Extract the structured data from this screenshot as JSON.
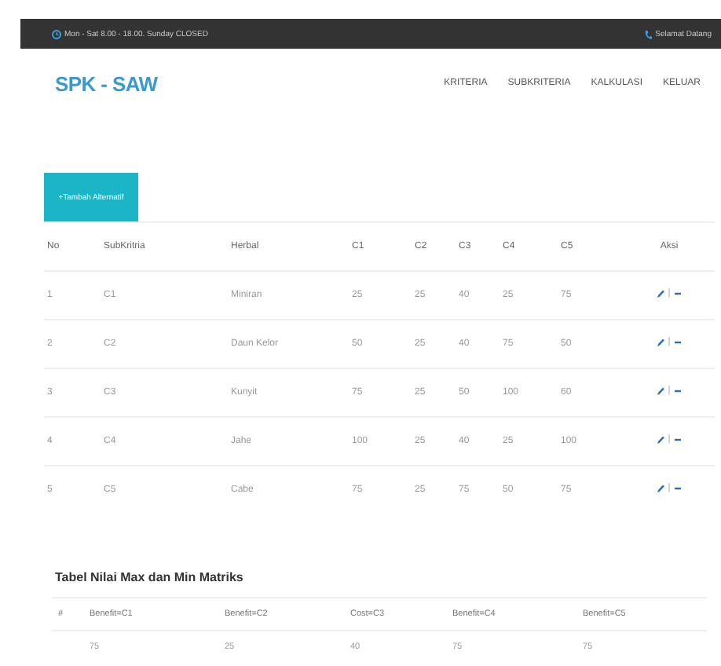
{
  "top_bar": {
    "hours": "Mon - Sat 8.00 - 18.00. Sunday CLOSED",
    "greeting": "Selamat Datang"
  },
  "header": {
    "logo": "SPK - SAW",
    "nav": [
      {
        "label": "KRITERIA"
      },
      {
        "label": "SUBKRITERIA"
      },
      {
        "label": "KALKULASI"
      },
      {
        "label": "KELUAR"
      }
    ]
  },
  "add_button": "+Tambah Alternatif",
  "table": {
    "columns": [
      "No",
      "SubKritria",
      "Herbal",
      "C1",
      "C2",
      "C3",
      "C4",
      "C5",
      "Aksi"
    ],
    "rows": [
      {
        "cells": [
          "1",
          "C1",
          "Miniran",
          "25",
          "25",
          "40",
          "25",
          "75"
        ],
        "separator": "|"
      },
      {
        "cells": [
          "2",
          "C2",
          "Daun Kelor",
          "50",
          "25",
          "40",
          "75",
          "50"
        ],
        "separator": "|"
      },
      {
        "cells": [
          "3",
          "C3",
          "Kunyit",
          "75",
          "25",
          "50",
          "100",
          "60"
        ],
        "separator": "|"
      },
      {
        "cells": [
          "4",
          "C4",
          "Jahe",
          "100",
          "25",
          "40",
          "25",
          "100"
        ],
        "separator": "|"
      },
      {
        "cells": [
          "5",
          "C5",
          "Cabe",
          "75",
          "25",
          "75",
          "50",
          "75"
        ],
        "separator": "|"
      }
    ]
  },
  "matrix": {
    "title": "Tabel Nilai Max dan Min Matriks",
    "columns": [
      "#",
      "Benefit=C1",
      "Benefit=C2",
      "Cost=C3",
      "Benefit=C4",
      "Benefit=C5"
    ],
    "rows": [
      {
        "cells": [
          "",
          "75",
          "25",
          "40",
          "75",
          "75"
        ]
      }
    ]
  }
}
